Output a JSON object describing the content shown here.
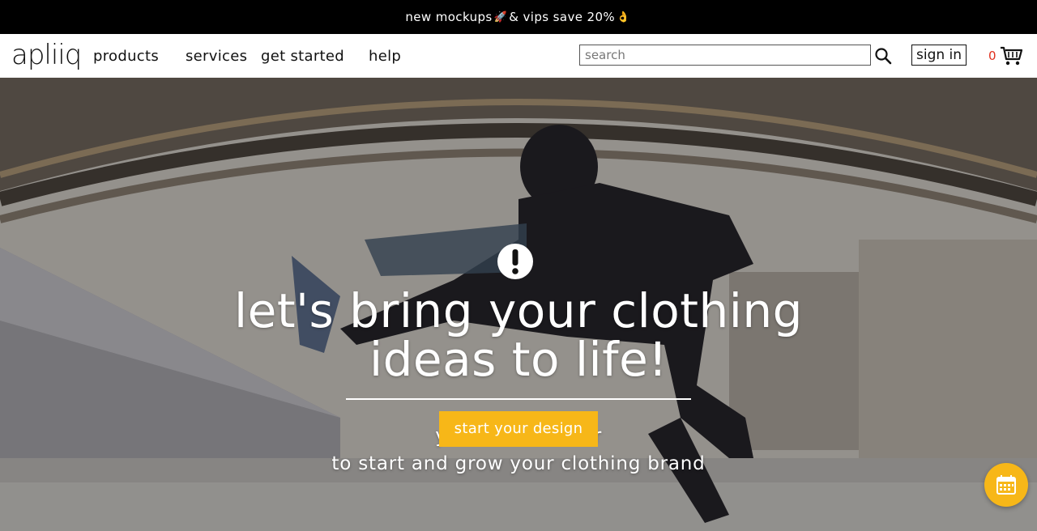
{
  "promo": {
    "text_before": "new mockups ",
    "rocket": "🚀",
    "text_middle": "& vips save 20% ",
    "hand": "👌"
  },
  "nav": {
    "logo": "apliiq",
    "links": [
      "products",
      "services",
      "get started",
      "help"
    ],
    "search_placeholder": "search",
    "sign_in": "sign in",
    "cart_count": "0"
  },
  "hero": {
    "headline_line1": "let's bring your clothing",
    "headline_line2": "ideas to life!",
    "cta": "start your design",
    "sub_line1_left": "yo",
    "sub_line1_right": "er",
    "sub_line2": "to start and grow your clothing brand"
  },
  "colors": {
    "accent": "#f7b718",
    "cart_count": "#e0301e",
    "promo_bg": "#000000"
  },
  "icons": [
    "search-icon",
    "cart-icon",
    "alert-icon",
    "calendar-icon"
  ]
}
